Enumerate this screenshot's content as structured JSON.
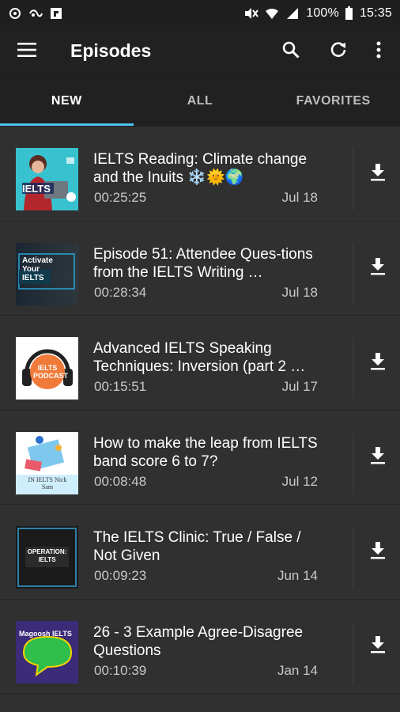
{
  "statusbar": {
    "battery": "100%",
    "time": "15:35"
  },
  "appbar": {
    "title": "Episodes"
  },
  "tabs": [
    {
      "label": "NEW"
    },
    {
      "label": "ALL"
    },
    {
      "label": "FAVORITES"
    }
  ],
  "episodes": [
    {
      "title": "IELTS Reading: Climate change and the Inuits ❄️🌞🌍",
      "duration": "00:25:25",
      "date": "Jul 18",
      "thumb_text": "IELTS"
    },
    {
      "title": "Episode 51: Attendee Ques-tions from the IELTS Writing …",
      "duration": "00:28:34",
      "date": "Jul 18",
      "thumb_text": "Activate Your IELTS"
    },
    {
      "title": "Advanced IELTS Speaking Techniques: Inversion (part 2 …",
      "duration": "00:15:51",
      "date": "Jul 17",
      "thumb_text": "IELTS PODCAST"
    },
    {
      "title": "How to make the leap from IELTS band score 6 to 7?",
      "duration": "00:08:48",
      "date": "Jul 12",
      "thumb_text": "IN IELTS Nick Sam"
    },
    {
      "title": "The IELTS Clinic: True / False / Not Given",
      "duration": "00:09:23",
      "date": "Jun 14",
      "thumb_text": "OPERATION: IELTS"
    },
    {
      "title": "26 - 3 Example Agree-Disagree Questions",
      "duration": "00:10:39",
      "date": "Jan 14",
      "thumb_text": "Magoosh IELTS"
    }
  ]
}
